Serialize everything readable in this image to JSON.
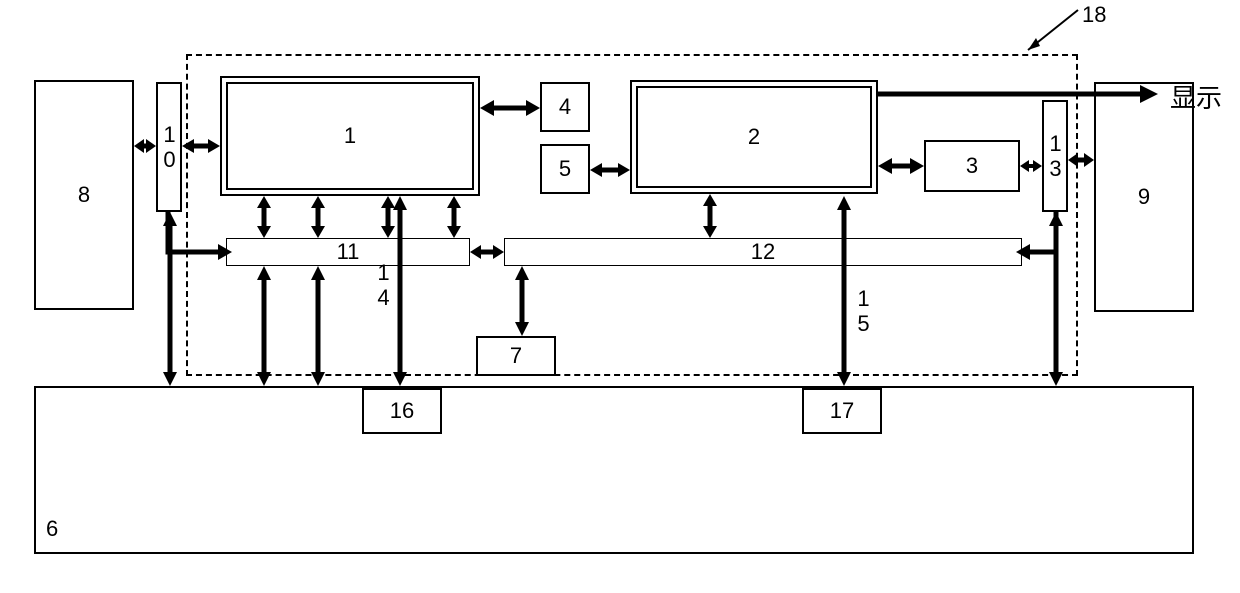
{
  "blocks": {
    "b1": "1",
    "b2": "2",
    "b3": "3",
    "b4": "4",
    "b5": "5",
    "b6": "6",
    "b7": "7",
    "b8": "8",
    "b9": "9",
    "b10": "10",
    "b11": "11",
    "b12": "12",
    "b13": "13",
    "b16": "16",
    "b17": "17"
  },
  "labels": {
    "l14": "14",
    "l15": "15",
    "l18": "18",
    "out": "显示"
  },
  "chart_data": {
    "type": "diagram",
    "description": "Block diagram with numbered rectangular components (1–18) connected by single- and double-headed arrows. A dashed rectangle (18) groups the central components. An output arrow from block 2 is labeled 显示 (display).",
    "nodes": [
      {
        "id": 1,
        "kind": "block",
        "double_border": true
      },
      {
        "id": 2,
        "kind": "block",
        "double_border": true
      },
      {
        "id": 3,
        "kind": "block"
      },
      {
        "id": 4,
        "kind": "block"
      },
      {
        "id": 5,
        "kind": "block"
      },
      {
        "id": 6,
        "kind": "block_large_bottom"
      },
      {
        "id": 7,
        "kind": "block"
      },
      {
        "id": 8,
        "kind": "block"
      },
      {
        "id": 9,
        "kind": "block"
      },
      {
        "id": 10,
        "kind": "block",
        "vertical_label": true
      },
      {
        "id": 11,
        "kind": "bus"
      },
      {
        "id": 12,
        "kind": "bus"
      },
      {
        "id": 13,
        "kind": "block",
        "vertical_label": true
      },
      {
        "id": 14,
        "kind": "connection_label"
      },
      {
        "id": 15,
        "kind": "connection_label"
      },
      {
        "id": 16,
        "kind": "block"
      },
      {
        "id": 17,
        "kind": "block"
      },
      {
        "id": 18,
        "kind": "dashed_group",
        "contains": [
          1,
          2,
          3,
          4,
          5,
          7,
          11,
          12,
          14,
          15
        ]
      }
    ],
    "edges": [
      {
        "from": 8,
        "to": 10,
        "type": "bidirectional"
      },
      {
        "from": 10,
        "to": 1,
        "type": "bidirectional"
      },
      {
        "from": 1,
        "to": 4,
        "type": "bidirectional"
      },
      {
        "from": 5,
        "to": 2,
        "type": "bidirectional"
      },
      {
        "from": 2,
        "to": 3,
        "type": "bidirectional"
      },
      {
        "from": 3,
        "to": 13,
        "type": "bidirectional"
      },
      {
        "from": 13,
        "to": 9,
        "type": "bidirectional"
      },
      {
        "from": 1,
        "to": 11,
        "type": "bidirectional",
        "count": 4
      },
      {
        "from": 2,
        "to": 12,
        "type": "bidirectional"
      },
      {
        "from": 11,
        "to": 12,
        "type": "bidirectional"
      },
      {
        "from": 11,
        "to": 6,
        "type": "bidirectional",
        "count": 2
      },
      {
        "from": 1,
        "to": 6,
        "type": "bidirectional",
        "via": 14
      },
      {
        "from": 12,
        "to": 6,
        "type": "bidirectional",
        "via": 15
      },
      {
        "from": 12,
        "to": 7,
        "type": "bidirectional"
      },
      {
        "from": 10,
        "to": 11,
        "type": "unidirectional_elbow",
        "direction": "to"
      },
      {
        "from": 13,
        "to": 12,
        "type": "unidirectional_elbow",
        "direction": "to"
      },
      {
        "from": 10,
        "to": 6,
        "type": "bidirectional"
      },
      {
        "from": 13,
        "to": 6,
        "type": "bidirectional"
      },
      {
        "from": 2,
        "to": "output",
        "type": "unidirectional",
        "label": "显示"
      }
    ]
  }
}
